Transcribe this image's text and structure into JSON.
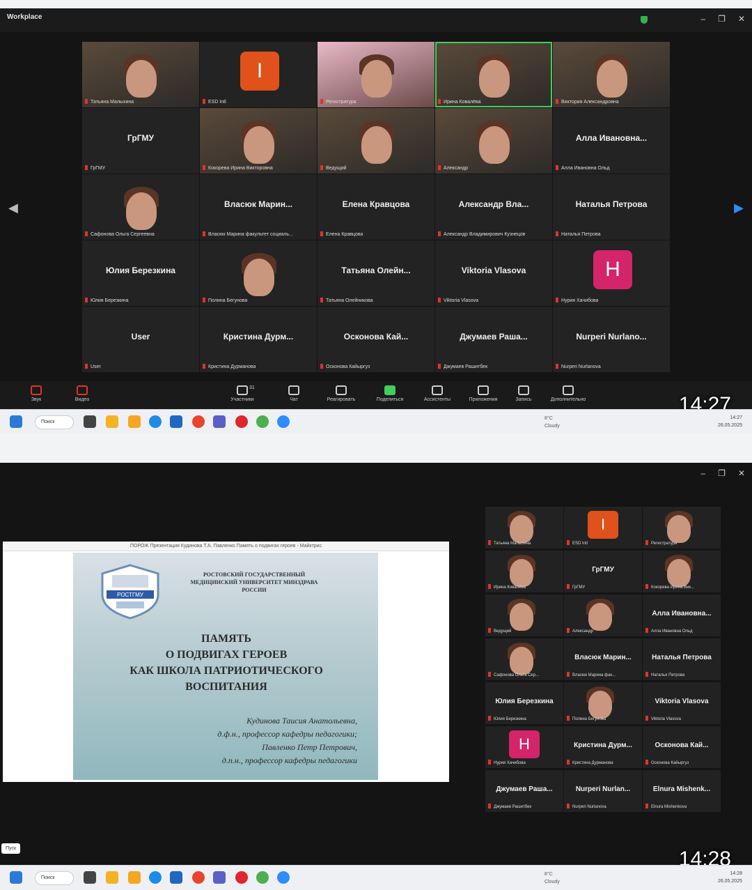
{
  "screen1": {
    "app_title": "Workplace",
    "timestamp": "14:27",
    "window_controls": [
      "–",
      "❐",
      "✕"
    ],
    "gallery": [
      {
        "kind": "video",
        "label": "Татьяна Малыхина"
      },
      {
        "kind": "avatar",
        "letter": "I",
        "color": "#e0511b",
        "label": "ESD Intl"
      },
      {
        "kind": "video-pink",
        "label": "Регистратура"
      },
      {
        "kind": "video",
        "active": true,
        "label": "Ирина Ковалёва"
      },
      {
        "kind": "video",
        "label": "Виктория Александровна"
      },
      {
        "kind": "name",
        "name": "ГрГМУ",
        "label": "ГрГМУ"
      },
      {
        "kind": "video",
        "label": "Кокорева Ирина Викторовна"
      },
      {
        "kind": "video",
        "label": "Ведущий"
      },
      {
        "kind": "video",
        "label": "Александр"
      },
      {
        "kind": "name",
        "name": "Алла Ивановна...",
        "label": "Алла Ивановна Ольд"
      },
      {
        "kind": "photo",
        "label": "Сафонова Ольга Сергеевна"
      },
      {
        "kind": "name",
        "name": "Власюк Марин...",
        "label": "Власюк Марина факультет социаль..."
      },
      {
        "kind": "name",
        "name": "Елена Кравцова",
        "label": "Елена Кравцова"
      },
      {
        "kind": "name",
        "name": "Александр Вла...",
        "label": "Александр Владимирович Кузнецов"
      },
      {
        "kind": "name",
        "name": "Наталья Петрова",
        "label": "Наталья Петрова"
      },
      {
        "kind": "name",
        "name": "Юлия Березкина",
        "label": "Юлия Березкина"
      },
      {
        "kind": "photo",
        "label": "Полина Бегунова"
      },
      {
        "kind": "name",
        "name": "Татьяна Олейн...",
        "label": "Татьяна Олейникова"
      },
      {
        "kind": "name",
        "name": "Viktoria Vlasova",
        "label": "Viktoria Vlasova"
      },
      {
        "kind": "avatar",
        "letter": "H",
        "color": "#d4246a",
        "label": "Нурия Хачибова"
      },
      {
        "kind": "name",
        "name": "User",
        "label": "User"
      },
      {
        "kind": "name",
        "name": "Кристина Дурм...",
        "label": "Кристина Дурманова"
      },
      {
        "kind": "name",
        "name": "Осконова Кай...",
        "label": "Осконова Кайыргуз"
      },
      {
        "kind": "name",
        "name": "Джумаев Раша...",
        "label": "Джумаев Рашитбек"
      },
      {
        "kind": "name",
        "name": "Nurperi Nurlano...",
        "label": "Nurperi Nurlanova"
      }
    ],
    "toolbar": [
      {
        "label": "Звук"
      },
      {
        "label": "Видео"
      },
      {
        "label": "Участники",
        "count": "31"
      },
      {
        "label": "Чат"
      },
      {
        "label": "Реагировать"
      },
      {
        "label": "Поделиться"
      },
      {
        "label": "Ассистенты"
      },
      {
        "label": "Приложения"
      },
      {
        "label": "Запись"
      },
      {
        "label": "Дополнительно"
      }
    ]
  },
  "screen2": {
    "timestamp": "14:28",
    "window_controls": [
      "–",
      "❐",
      "✕"
    ],
    "tooltip": "Пуск",
    "presentation": {
      "window_title": "ПОРОЖ Презентация Кудинова Т.А. Павленко Память о подвигах героев - Майктрис",
      "university": "РОСТОВСКИЙ ГОСУДАРСТВЕННЫЙ МЕДИЦИНСКИЙ УНИВЕРСИТЕТ МИНЗДРАВА РОССИИ",
      "logo_text": "РОСТГМУ",
      "title_lines": [
        "ПАМЯТЬ",
        "О ПОДВИГАХ ГЕРОЕВ",
        "КАК ШКОЛА ПАТРИОТИЧЕСКОГО",
        "ВОСПИТАНИЯ"
      ],
      "author_lines": [
        "Кудинова Таисия Анатольевна,",
        "д.ф.н., профессор кафедры педагогики;",
        "Павленко Петр Петрович,",
        "д.п.н., профессор кафедры педагогики"
      ]
    },
    "gallery": [
      {
        "kind": "video",
        "label": "Татьяна Малыхина"
      },
      {
        "kind": "avatar",
        "letter": "I",
        "color": "#e0511b",
        "label": "ESD Intl"
      },
      {
        "kind": "video-pink",
        "label": "Регистратура"
      },
      {
        "kind": "video",
        "label": "Ирина Ковалёва"
      },
      {
        "kind": "name",
        "name": "ГрГМУ",
        "label": "ГрГМУ"
      },
      {
        "kind": "video",
        "label": "Кокорева Ирина Вик..."
      },
      {
        "kind": "video",
        "active": true,
        "label": "Ведущий"
      },
      {
        "kind": "video",
        "label": "Александр"
      },
      {
        "kind": "name",
        "name": "Алла Ивановна...",
        "label": "Алла Ивановна Ольд"
      },
      {
        "kind": "photo",
        "label": "Сафонова Ольга Сер..."
      },
      {
        "kind": "name",
        "name": "Власюк Марин...",
        "label": "Власюк Марина фак..."
      },
      {
        "kind": "name",
        "name": "Наталья Петрова",
        "label": "Наталья Петрова"
      },
      {
        "kind": "name",
        "name": "Юлия Березкина",
        "label": "Юлия Березкина"
      },
      {
        "kind": "photo",
        "label": "Полина Бегунова"
      },
      {
        "kind": "name",
        "name": "Viktoria Vlasova",
        "label": "Viktoria Vlasova"
      },
      {
        "kind": "avatar",
        "letter": "H",
        "color": "#d4246a",
        "label": "Нурия Хачибова"
      },
      {
        "kind": "name",
        "name": "Кристина Дурм...",
        "label": "Кристина Дурманова"
      },
      {
        "kind": "name",
        "name": "Осконова Кай...",
        "label": "Осконова Кайыргуз"
      },
      {
        "kind": "name",
        "name": "Джумаев Раша...",
        "label": "Джумаев Рашитбек"
      },
      {
        "kind": "name",
        "name": "Nurperi Nurlan...",
        "label": "Nurperi Nurlanova"
      },
      {
        "kind": "name",
        "name": "Elnura Mishenk...",
        "label": "Elnura Mishenkova"
      }
    ]
  },
  "taskbar": {
    "search_label": "Поиск",
    "weather_temp": "8°C",
    "weather_text": "Cloudy",
    "clock_time": "14:27",
    "clock_date": "26.05.2025",
    "clock_time_2": "14:28"
  }
}
